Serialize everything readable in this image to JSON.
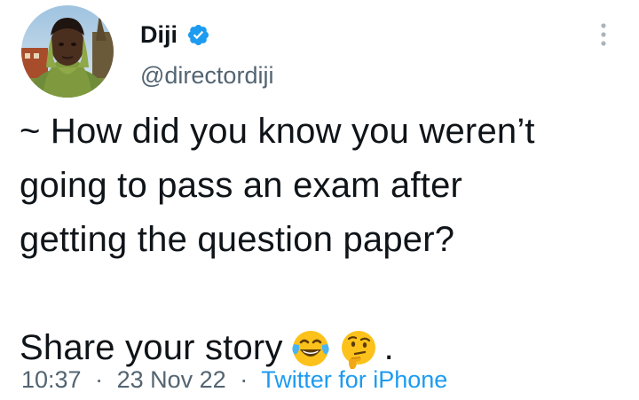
{
  "author": {
    "display_name": "Diji",
    "handle": "@directordiji",
    "verified": true,
    "avatar_icon": "profile-photo"
  },
  "tweet": {
    "lines": [
      "~ How did you know you weren’t",
      "going to pass an exam after",
      "getting the question paper?"
    ],
    "share_text": "Share your story",
    "emojis": [
      "face-with-tears-of-joy",
      "thinking-face"
    ],
    "trailing_punctuation": "."
  },
  "meta": {
    "time": "10:37",
    "separator": "·",
    "date": "23 Nov 22",
    "source": "Twitter for iPhone"
  },
  "colors": {
    "text_primary": "#0f1419",
    "text_secondary": "#536471",
    "accent": "#1d9bf0"
  }
}
